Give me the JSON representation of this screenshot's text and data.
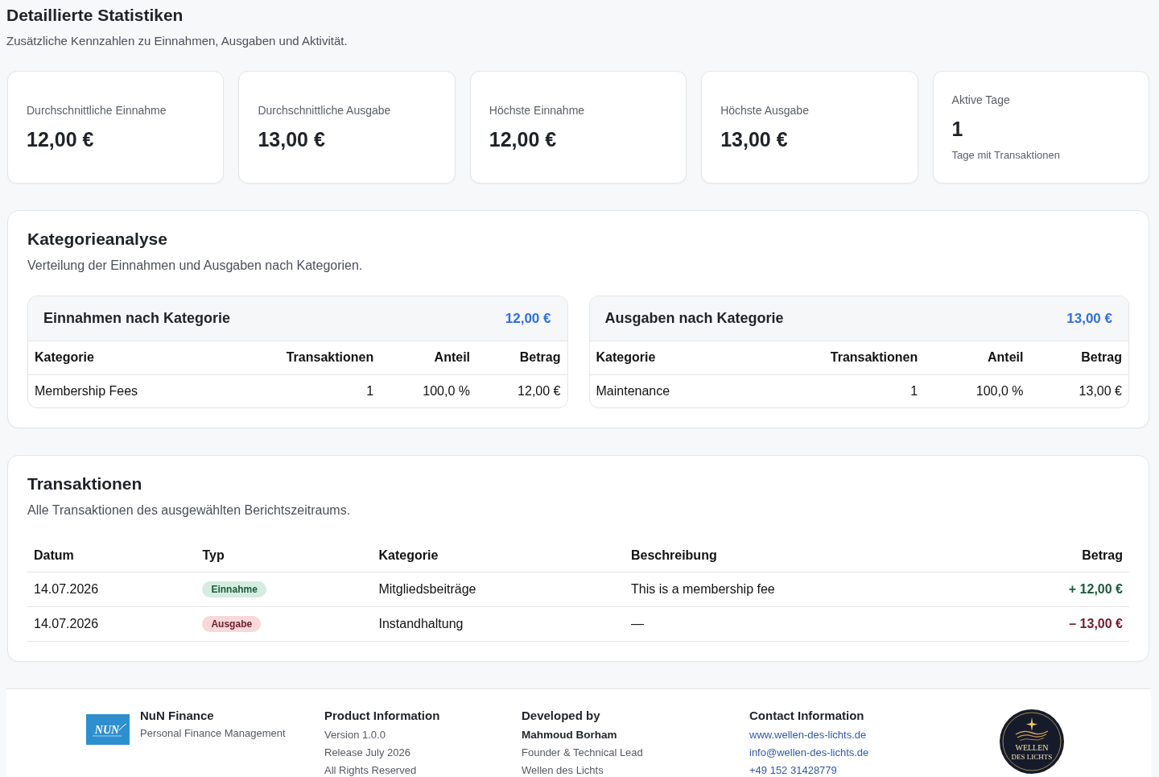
{
  "header": {
    "title": "Detaillierte Statistiken",
    "subtitle": "Zusätzliche Kennzahlen zu Einnahmen, Ausgaben und Aktivität."
  },
  "stat_cards": [
    {
      "label": "Durchschnittliche Einnahme",
      "value": "12,00 €"
    },
    {
      "label": "Durchschnittliche Ausgabe",
      "value": "13,00 €"
    },
    {
      "label": "Höchste Einnahme",
      "value": "12,00 €"
    },
    {
      "label": "Höchste Ausgabe",
      "value": "13,00 €"
    },
    {
      "label": "Aktive Tage",
      "value": "1",
      "note": "Tage mit Transaktionen"
    }
  ],
  "category_analysis": {
    "title": "Kategorieanalyse",
    "subtitle": "Verteilung der Einnahmen und Ausgaben nach Kategorien.",
    "tables": [
      {
        "title": "Einnahmen nach Kategorie",
        "total": "12,00 €",
        "columns": [
          "Kategorie",
          "Transaktionen",
          "Anteil",
          "Betrag"
        ],
        "rows": [
          [
            "Membership Fees",
            "1",
            "100,0 %",
            "12,00 €"
          ]
        ]
      },
      {
        "title": "Ausgaben nach Kategorie",
        "total": "13,00 €",
        "columns": [
          "Kategorie",
          "Transaktionen",
          "Anteil",
          "Betrag"
        ],
        "rows": [
          [
            "Maintenance",
            "1",
            "100,0 %",
            "13,00 €"
          ]
        ]
      }
    ]
  },
  "transactions": {
    "title": "Transaktionen",
    "subtitle": "Alle Transaktionen des ausgewählten Berichtszeitraums.",
    "columns": [
      "Datum",
      "Typ",
      "Kategorie",
      "Beschreibung",
      "Betrag"
    ],
    "rows": [
      {
        "date": "14.07.2026",
        "kind": "income",
        "type": "Einnahme",
        "category": "Mitgliedsbeiträge",
        "description": "This is a membership fee",
        "amount": "+ 12,00 €"
      },
      {
        "date": "14.07.2026",
        "kind": "expense",
        "type": "Ausgabe",
        "category": "Instandhaltung",
        "description": "—",
        "amount": "– 13,00 €"
      }
    ]
  },
  "footer": {
    "brand": {
      "logo_text": "NUN",
      "name": "NuN Finance",
      "tagline": "Personal Finance Management"
    },
    "columns": [
      {
        "heading": "Product Information",
        "lines": [
          {
            "kind": "text",
            "text": "Version 1.0.0"
          },
          {
            "kind": "text",
            "text": "Release July 2026"
          },
          {
            "kind": "text",
            "text": "All Rights Reserved"
          }
        ]
      },
      {
        "heading": "Developed by",
        "lines": [
          {
            "kind": "strong",
            "text": "Mahmoud Borham"
          },
          {
            "kind": "text",
            "text": "Founder & Technical Lead"
          },
          {
            "kind": "text",
            "text": "Wellen des Lichts"
          }
        ]
      },
      {
        "heading": "Contact Information",
        "lines": [
          {
            "kind": "link",
            "text": "www.wellen-des-lichts.de"
          },
          {
            "kind": "link",
            "text": "info@wellen-des-lichts.de"
          },
          {
            "kind": "link",
            "text": "+49 152 31428779"
          }
        ]
      }
    ],
    "partner_logo": {
      "lines": [
        "WELLEN",
        "DES LICHTS"
      ]
    }
  }
}
